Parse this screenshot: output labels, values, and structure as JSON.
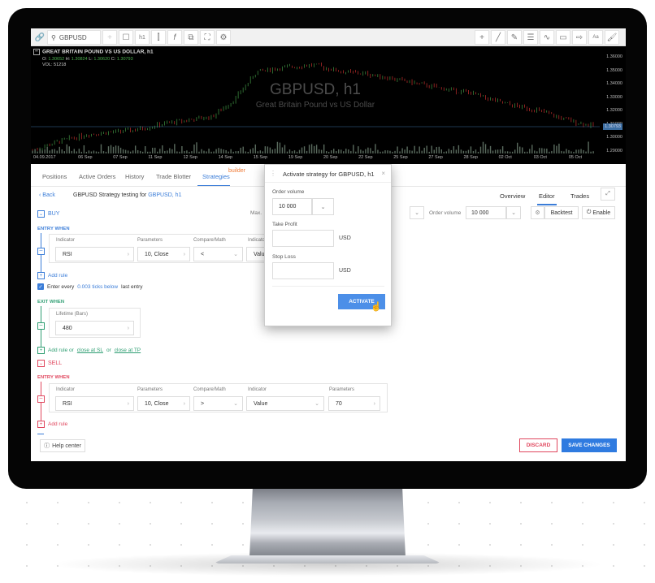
{
  "toolbar": {
    "search_value": "GBPUSD",
    "timeframe": "h1",
    "left_icons": [
      "link-icon",
      "search-icon",
      "plus-icon",
      "square-icon",
      "timeframe-button",
      "candles-icon",
      "indicators-icon",
      "templates-icon",
      "fullscreen-icon",
      "settings-icon"
    ],
    "right_icons": [
      "crosshair-icon",
      "line-icon",
      "pencil-icon",
      "fibonacci-icon",
      "wave-icon",
      "rectangle-icon",
      "arrow-icon",
      "text-icon",
      "brush-icon"
    ],
    "text_tool_label": "Aa"
  },
  "chart": {
    "header": "GREAT BRITAIN POUND VS US DOLLAR, h1",
    "ohlc": {
      "o_label": "O:",
      "o": "1.30652",
      "h_label": "H:",
      "h": "1.30824",
      "l_label": "L:",
      "l": "1.30620",
      "c_label": "C:",
      "c": "1.30793"
    },
    "volume": "VOL: 51218",
    "watermark_title": "GBPUSD, h1",
    "watermark_subtitle": "Great Britain Pound vs US Dollar",
    "y_ticks": [
      "1.36000",
      "1.35000",
      "1.34000",
      "1.33000",
      "1.32000",
      "1.31000",
      "1.30000",
      "1.29000"
    ],
    "x_ticks": [
      "04.09.2017",
      "06 Sep",
      "07 Sep",
      "11 Sep",
      "12 Sep",
      "14 Sep",
      "15 Sep",
      "19 Sep",
      "20 Sep",
      "22 Sep",
      "25 Sep",
      "27 Sep",
      "28 Sep",
      "02 Oct",
      "03 Oct",
      "05 Oct"
    ],
    "current_price": "1.30793",
    "colors": {
      "up": "#4caf50",
      "down": "#e53935",
      "volume": "#5a6b5e"
    }
  },
  "tabs": {
    "items": [
      "Positions",
      "Active Orders",
      "History",
      "Trade Blotter",
      "Strategies"
    ],
    "active": "Strategies",
    "badge": "builder"
  },
  "subheader": {
    "back": "Back",
    "title_prefix": "GBPUSD Strategy testing for",
    "title_link": "GBPUSD, h1",
    "right_tabs": [
      "Overview",
      "Editor",
      "Trades"
    ],
    "active_right_tab": "Editor"
  },
  "controls": {
    "max_label": "Max.",
    "order_volume_label": "Order volume",
    "order_volume_value": "10 000",
    "backtest": "Backtest",
    "enable": "Enable"
  },
  "buy": {
    "label": "BUY",
    "entry_when": "ENTRY WHEN",
    "rule": {
      "labels": [
        "Indicator",
        "Parameters",
        "Compare/Math",
        "Indicator"
      ],
      "values": [
        "RSI",
        "10, Close",
        "<",
        "Value"
      ]
    },
    "add_rule": "Add rule",
    "enter_every": {
      "prefix": "Enter every",
      "link": "0.003 ticks below",
      "suffix": "last entry",
      "checked": true
    },
    "exit_when": "EXIT WHEN",
    "lifetime_label": "Lifetime (Bars)",
    "lifetime_value": "480",
    "exit_add": {
      "prefix": "Add rule or",
      "close_sl": "close at SL",
      "or": "or",
      "close_tp": "close at TP"
    }
  },
  "sell": {
    "label": "SELL",
    "entry_when": "ENTRY WHEN",
    "rule": {
      "labels": [
        "Indicator",
        "Parameters",
        "Compare/Math",
        "Indicator",
        "Parameters"
      ],
      "values": [
        "RSI",
        "10, Close",
        ">",
        "Value",
        "70"
      ]
    },
    "add_rule": "Add rule"
  },
  "footer": {
    "help": "Help center",
    "discard": "DISCARD",
    "save": "SAVE CHANGES"
  },
  "modal": {
    "title": "Activate strategy for GBPUSD, h1",
    "order_volume_label": "Order volume",
    "order_volume_value": "10 000",
    "take_profit_label": "Take Profit",
    "take_profit_value": "",
    "stop_loss_label": "Stop Loss",
    "stop_loss_value": "",
    "currency": "USD",
    "activate": "ACTIVATE"
  },
  "colors": {
    "accent": "#3b7dd8",
    "buy_entry": "#3b7dd8",
    "exit": "#2e9e72",
    "sell": "#e0465d",
    "builder": "#f07a35",
    "save": "#2f7be0"
  }
}
